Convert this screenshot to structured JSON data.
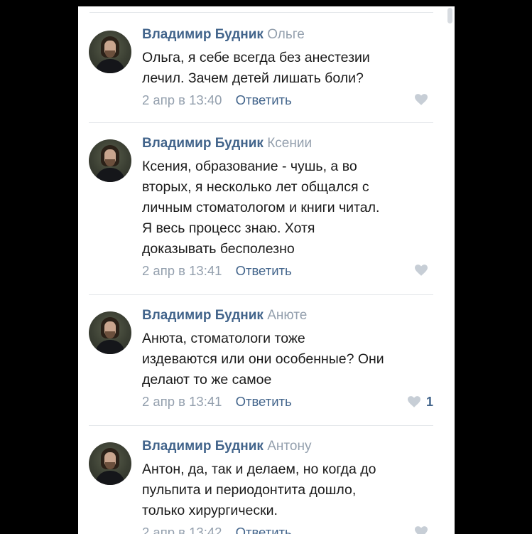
{
  "comments": [
    {
      "author": "Владимир Будник",
      "reply_to": "Ольге",
      "lines": [
        "Ольга, я себе всегда без анестезии",
        "лечил. Зачем детей лишать боли?"
      ],
      "date": "2 апр в 13:40",
      "reply_label": "Ответить",
      "likes": ""
    },
    {
      "author": "Владимир Будник",
      "reply_to": "Ксении",
      "lines": [
        "Ксения, образование - чушь, а во",
        "вторых, я несколько лет общался с",
        "личным стоматологом и книги читал.",
        "Я весь процесс знаю. Хотя",
        "доказывать бесполезно"
      ],
      "date": "2 апр в 13:41",
      "reply_label": "Ответить",
      "likes": ""
    },
    {
      "author": "Владимир Будник",
      "reply_to": "Анюте",
      "lines": [
        "Анюта, стоматологи тоже",
        "издеваются или они особенные? Они",
        "делают то же самое"
      ],
      "date": "2 апр в 13:41",
      "reply_label": "Ответить",
      "likes": "1"
    },
    {
      "author": "Владимир Будник",
      "reply_to": "Антону",
      "lines": [
        "Антон, да, так и делаем, но когда до",
        "пульпита и периодонтита дошло,",
        "только хирургически."
      ],
      "date": "2 апр в 13:42",
      "reply_label": "Ответить",
      "likes": ""
    }
  ],
  "colors": {
    "author": "#42648b",
    "muted": "#939fad",
    "text": "#1a1a1a",
    "heart": "#c7ced6"
  },
  "icons": {
    "like": "heart-icon",
    "avatar": "user-avatar"
  }
}
